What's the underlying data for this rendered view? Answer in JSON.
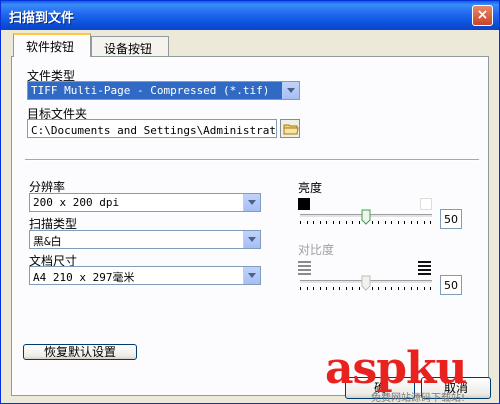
{
  "window": {
    "title": "扫描到文件",
    "close_label": "×"
  },
  "tabs": [
    {
      "label": "软件按钮",
      "active": true
    },
    {
      "label": "设备按钮",
      "active": false
    }
  ],
  "file_type": {
    "label": "文件类型",
    "value": "TIFF Multi-Page - Compressed (*.tif)"
  },
  "target_folder": {
    "label": "目标文件夹",
    "value": "C:\\Documents and Settings\\Administrator\\桌面"
  },
  "resolution": {
    "label": "分辨率",
    "value": "200 x 200 dpi"
  },
  "scan_type": {
    "label": "扫描类型",
    "value": "黑&白"
  },
  "document_size": {
    "label": "文档尺寸",
    "value": "A4 210 x 297毫米"
  },
  "brightness": {
    "label": "亮度",
    "value": "50",
    "level": 50
  },
  "contrast": {
    "label": "对比度",
    "value": "50",
    "level": 50
  },
  "buttons": {
    "restore_defaults": "恢复默认设置",
    "ok": "确",
    "cancel": "取消"
  },
  "watermark": {
    "text": "aspku",
    "tagline": "免费网站源码下载站!"
  }
}
